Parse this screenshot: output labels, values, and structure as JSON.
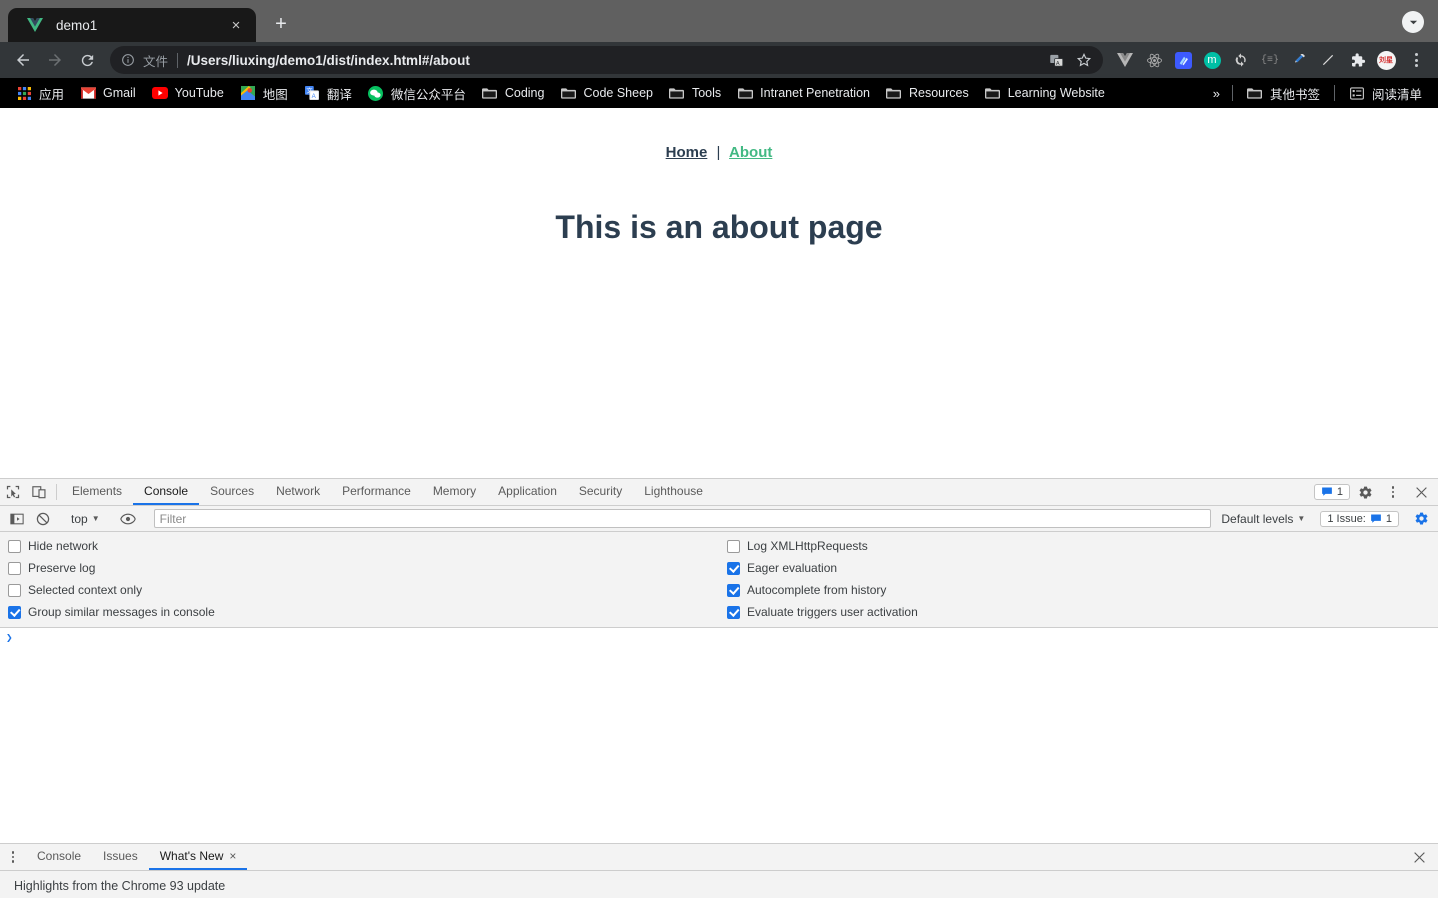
{
  "browser": {
    "tab": {
      "title": "demo1",
      "favicon": "vue-logo-icon",
      "close_label": "×"
    },
    "new_tab_label": "+",
    "tab_search_icon": "chevron-down-icon",
    "toolbar": {
      "back_icon": "arrow-left-icon",
      "forward_icon": "arrow-right-icon",
      "reload_icon": "reload-icon",
      "info_icon": "info-circle-icon",
      "scheme_label": "文件",
      "url": "/Users/liuxing/demo1/dist/index.html#/about",
      "translate_icon": "translate-icon",
      "bookmark_star_icon": "star-icon",
      "extensions": [
        {
          "name": "vue-devtools-icon",
          "glyph": "V",
          "color": "#b4b4b4"
        },
        {
          "name": "react-devtools-icon",
          "glyph": "⚛",
          "color": "#b0b0b0"
        },
        {
          "name": "blue-extension-icon",
          "glyph": "",
          "color": "#3d5afe"
        },
        {
          "name": "momentum-extension-icon",
          "glyph": "m",
          "color": "#00bfa5"
        },
        {
          "name": "sync-extension-icon",
          "glyph": "⟳",
          "color": "#cfcfcf"
        },
        {
          "name": "code-extension-icon",
          "glyph": "{≡}",
          "color": "#8a8a8a"
        },
        {
          "name": "eyedropper-extension-icon",
          "glyph": "✒",
          "color": "#d8d8d8"
        },
        {
          "name": "line-extension-icon",
          "glyph": "∕",
          "color": "#d8d8d8"
        },
        {
          "name": "puzzle-extensions-icon",
          "glyph": "🧩",
          "color": "#e8eaed"
        }
      ],
      "profile_icon": "profile-avatar",
      "menu_icon": "three-dots-menu-icon"
    },
    "bookmarks": [
      {
        "label": "应用",
        "icon": "apps-grid-icon"
      },
      {
        "label": "Gmail",
        "icon": "gmail-icon"
      },
      {
        "label": "YouTube",
        "icon": "youtube-icon"
      },
      {
        "label": "地图",
        "icon": "maps-icon"
      },
      {
        "label": "翻译",
        "icon": "translate-icon"
      },
      {
        "label": "微信公众平台",
        "icon": "wechat-icon"
      },
      {
        "label": "Coding",
        "icon": "folder-icon"
      },
      {
        "label": "Code Sheep",
        "icon": "folder-icon"
      },
      {
        "label": "Tools",
        "icon": "folder-icon"
      },
      {
        "label": "Intranet Penetration",
        "icon": "folder-icon"
      },
      {
        "label": "Resources",
        "icon": "folder-icon"
      },
      {
        "label": "Learning Website",
        "icon": "folder-icon"
      }
    ],
    "bookmarks_overflow": "»",
    "other_bookmarks": {
      "label": "其他书签",
      "icon": "folder-icon"
    },
    "reading_list": {
      "label": "阅读清单",
      "icon": "reading-list-icon"
    }
  },
  "page": {
    "nav": {
      "home": "Home",
      "separator": "|",
      "about": "About"
    },
    "heading": "This is an about page",
    "colors": {
      "text": "#2c3e50",
      "accent": "#42b983"
    }
  },
  "devtools": {
    "inspect_icon": "inspect-element-icon",
    "device_toolbar_icon": "device-toolbar-icon",
    "tabs": [
      {
        "label": "Elements",
        "active": false
      },
      {
        "label": "Console",
        "active": true
      },
      {
        "label": "Sources",
        "active": false
      },
      {
        "label": "Network",
        "active": false
      },
      {
        "label": "Performance",
        "active": false
      },
      {
        "label": "Memory",
        "active": false
      },
      {
        "label": "Application",
        "active": false
      },
      {
        "label": "Security",
        "active": false
      },
      {
        "label": "Lighthouse",
        "active": false
      }
    ],
    "message_count": "1",
    "settings_icon": "gear-icon",
    "more_icon": "three-dots-menu-icon",
    "close_icon": "close-icon",
    "console_toolbar": {
      "sidebar_icon": "console-sidebar-icon",
      "clear_icon": "clear-console-icon",
      "context": "top",
      "eye_icon": "live-expression-eye-icon",
      "filter_placeholder": "Filter",
      "filter_value": "",
      "levels": "Default levels",
      "issues_label": "1 Issue:",
      "issues_count": "1",
      "console_settings_icon": "gear-icon"
    },
    "settings_left": [
      {
        "label": "Hide network",
        "checked": false
      },
      {
        "label": "Preserve log",
        "checked": false
      },
      {
        "label": "Selected context only",
        "checked": false
      },
      {
        "label": "Group similar messages in console",
        "checked": true
      }
    ],
    "settings_right": [
      {
        "label": "Log XMLHttpRequests",
        "checked": false
      },
      {
        "label": "Eager evaluation",
        "checked": true
      },
      {
        "label": "Autocomplete from history",
        "checked": true
      },
      {
        "label": "Evaluate triggers user activation",
        "checked": true
      }
    ],
    "prompt_symbol": "❯",
    "drawer": {
      "menu_icon": "three-dots-menu-icon",
      "tabs": [
        {
          "label": "Console",
          "active": false,
          "closable": false
        },
        {
          "label": "Issues",
          "active": false,
          "closable": false
        },
        {
          "label": "What's New",
          "active": true,
          "closable": true
        }
      ],
      "close_label": "×",
      "close_icon": "close-icon",
      "content": "Highlights from the Chrome 93 update"
    }
  }
}
